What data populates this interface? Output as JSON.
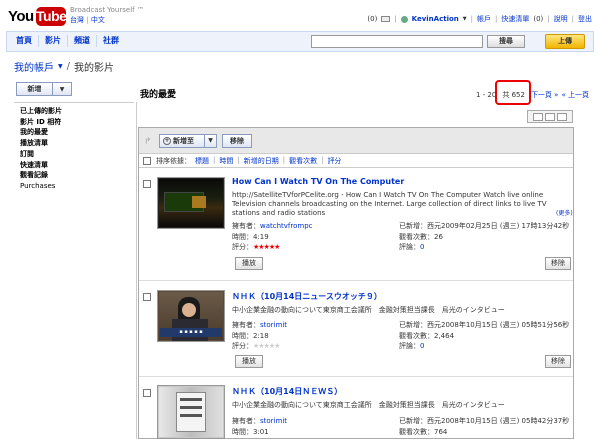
{
  "brand": {
    "logo_you": "You",
    "logo_tube": "Tube",
    "tagline": "Broadcast Yourself ™"
  },
  "languages": {
    "traditional": "台灣",
    "chinese": "中文"
  },
  "userbar": {
    "mail_count": "(0)",
    "username": "KevinAction",
    "account": "帳戶",
    "quicklist": "快速清單",
    "quicklist_count": "(0)",
    "help": "說明",
    "logout": "登出"
  },
  "nav": {
    "tabs": [
      "首頁",
      "影片",
      "頻道",
      "社群"
    ],
    "search_button": "搜尋",
    "search_placeholder": "",
    "upload": "上傳"
  },
  "breadcrumb": {
    "account": "我的帳戶",
    "current": "我的影片"
  },
  "left": {
    "new_button": "新增",
    "menu": [
      "已上傳的影片",
      "影片 ID 相符",
      "我的最愛",
      "播放清單",
      "訂閱",
      "快速清單",
      "觀看記錄",
      "Purchases"
    ]
  },
  "main": {
    "title": "我的最愛",
    "pager": {
      "range": "1 - 20",
      "total": "共 652",
      "next": "下一頁 »",
      "prev": "« 上一頁"
    },
    "toolbar": {
      "add_to": "新增至",
      "remove": "移除"
    },
    "sort": {
      "label": "排序依據：",
      "options": [
        "標題",
        "時間",
        "新增的日期",
        "觀看次數",
        "評分"
      ]
    }
  },
  "videos": [
    {
      "title": "How Can I Watch TV On The Computer",
      "description": "http://SatelliteTVforPCelite.org - How Can I Watch TV On The Computer Watch live online Television channels broadcasting on the Internet. Large collection of direct links to live TV stations and radio stations",
      "more": "(更多)",
      "owner_label": "擁有者：",
      "owner": "watchtvfrompc",
      "time_label": "時間：",
      "time": "4:19",
      "rating_label": "評分：",
      "rating": 5,
      "added_label": "已新增：",
      "added": "西元2009年02月25日 (週三) 17時13分42秒",
      "views_label": "觀看次數：",
      "views": "26",
      "comments_label": "評論：",
      "comments": "0",
      "play": "播放",
      "remove": "移除"
    },
    {
      "title": "ＮＨＫ（10月14日ニュースウオッチ９）",
      "description": "中小企業金融の動向について東京商工会議所　金融対策担当課長　烏光のインタビュー",
      "owner_label": "擁有者：",
      "owner": "storimit",
      "time_label": "時間：",
      "time": "2:18",
      "rating_label": "評分：",
      "rating": 0,
      "added_label": "已新增：",
      "added": "西元2008年10月15日 (週三) 05時51分56秒",
      "views_label": "觀看次數：",
      "views": "2,464",
      "comments_label": "評論：",
      "comments": "0",
      "play": "播放",
      "remove": "移除"
    },
    {
      "title": "ＮＨＫ（10月14日ＮＥＷＳ）",
      "description": "中小企業金融の動向について東京商工会議所　金融対策担当課長　烏光のインタビュー",
      "owner_label": "擁有者：",
      "owner": "storimit",
      "time_label": "時間：",
      "time": "3:01",
      "added_label": "已新增：",
      "added": "西元2008年10月15日 (週三) 05時42分37秒",
      "views_label": "觀看次數：",
      "views": "764"
    }
  ],
  "colors": {
    "link": "#0033cc",
    "star": "#ee0000",
    "highlight": "#ee0000",
    "upload": "#f2b400"
  }
}
